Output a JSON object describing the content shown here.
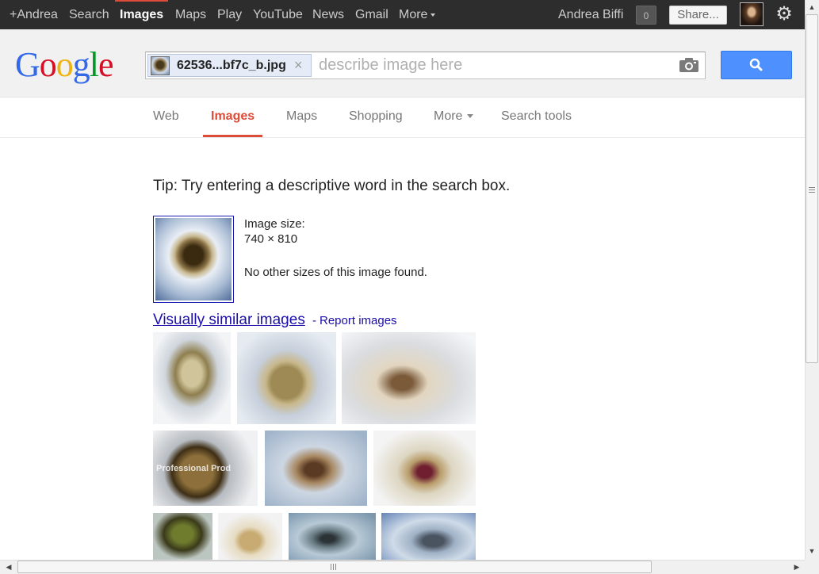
{
  "topbar": {
    "links": [
      {
        "label": "+Andrea"
      },
      {
        "label": "Search"
      },
      {
        "label": "Images"
      },
      {
        "label": "Maps"
      },
      {
        "label": "Play"
      },
      {
        "label": "YouTube"
      },
      {
        "label": "News"
      },
      {
        "label": "Gmail"
      },
      {
        "label": "More"
      }
    ],
    "user_name": "Andrea Biffi",
    "notification_count": "0",
    "share_label": "Share..."
  },
  "logo": {
    "text": "Google"
  },
  "search": {
    "chip_filename": "62536...bf7c_b.jpg",
    "chip_remove": "×",
    "placeholder": "describe image here",
    "value": ""
  },
  "tabs": [
    {
      "label": "Web"
    },
    {
      "label": "Images"
    },
    {
      "label": "Maps"
    },
    {
      "label": "Shopping"
    },
    {
      "label": "More"
    },
    {
      "label": "Search tools"
    }
  ],
  "content": {
    "tip": "Tip: Try entering a descriptive word in the search box.",
    "image_size_label": "Image size:",
    "image_size_value": "740 × 810",
    "no_other_sizes": "No other sizes of this image found.",
    "visually_similar_label": "Visually similar images",
    "separator": "-",
    "report_images_label": "Report images",
    "watermark_text": "Professional Prod"
  },
  "colors": {
    "topbar_bg": "#2d2d2d",
    "accent_red": "#dd4b39",
    "search_button_blue": "#4d90fe",
    "link_blue": "#1a0dab"
  }
}
